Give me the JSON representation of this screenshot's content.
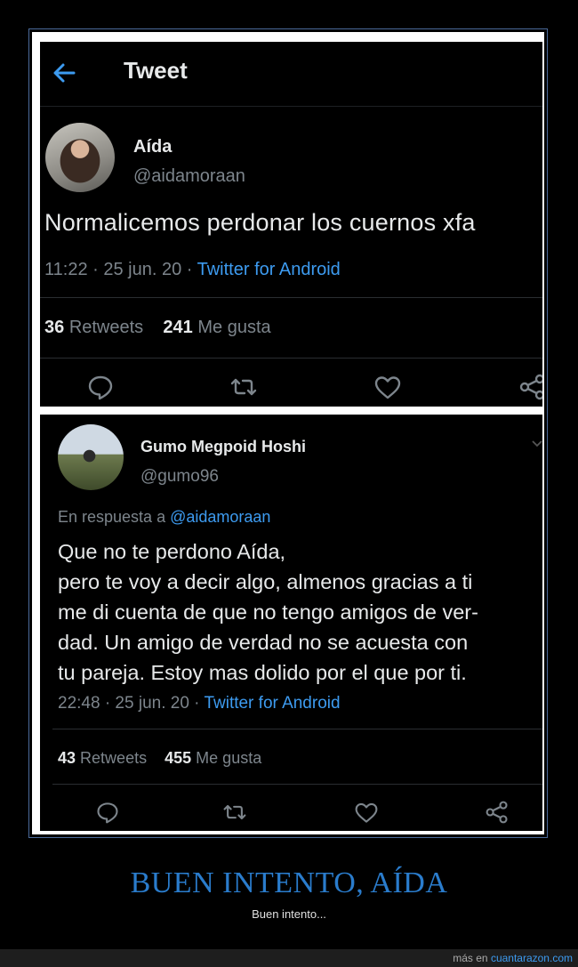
{
  "tweet1": {
    "header_title": "Tweet",
    "author_name": "Aída",
    "author_handle": "@aidamoraan",
    "text": "Normalicemos perdonar los cuernos xfa",
    "timestamp": "11:22 · 25 jun. 20 · ",
    "source": "Twitter for Android",
    "retweets_count": "36",
    "retweets_label": "Retweets",
    "likes_count": "241",
    "likes_label": "Me gusta"
  },
  "tweet2": {
    "author_name": "Gumo Megpoid Hoshi",
    "author_handle": "@gumo96",
    "reply_prefix": "En respuesta a ",
    "reply_handle": "@aidamoraan",
    "text_lines": [
      "Que no te perdono Aída,",
      "pero te voy a decir algo, almenos gracias a ti",
      "me di cuenta de que no tengo amigos de ver-",
      "dad. Un amigo de verdad no se acuesta con",
      "tu pareja. Estoy mas dolido por el que por ti."
    ],
    "timestamp": "22:48 · 25 jun. 20 · ",
    "source": "Twitter for Android",
    "retweets_count": "43",
    "retweets_label": "Retweets",
    "likes_count": "455",
    "likes_label": "Me gusta"
  },
  "page": {
    "title": "BUEN INTENTO, AÍDA",
    "subtitle": "Buen intento...",
    "footer_prefix": "más en ",
    "footer_link": "cuantarazon.com"
  },
  "colors": {
    "background": "#000000",
    "tweet_text": "#e7e9ea",
    "muted_text": "#7d858c",
    "link_blue": "#3d9bf0",
    "title_blue": "#2a7ccc"
  },
  "icons": [
    "back-arrow-icon",
    "reply-icon",
    "retweet-icon",
    "like-icon",
    "share-icon",
    "chevron-down-icon"
  ]
}
